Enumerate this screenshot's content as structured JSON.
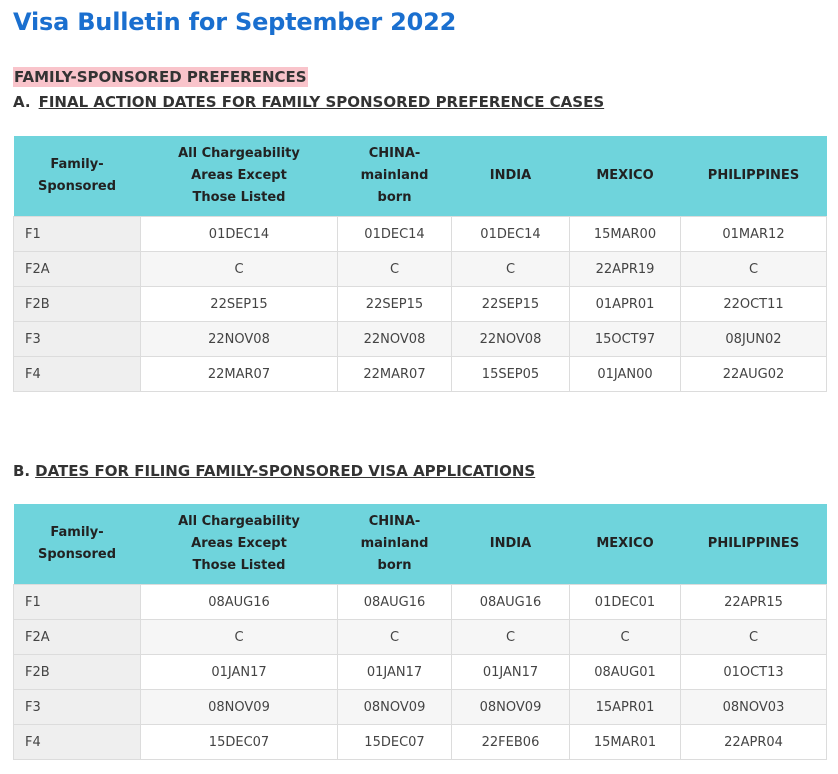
{
  "page": {
    "title": "Visa Bulletin for September 2022",
    "section_label": "FAMILY-SPONSORED PREFERENCES"
  },
  "columns": [
    "Family-\nSponsored",
    "All Chargeability\nAreas Except\nThose Listed",
    "CHINA-\nmainland\nborn",
    "INDIA",
    "MEXICO",
    "PHILIPPINES"
  ],
  "table_a": {
    "letter": "A.",
    "heading": "FINAL ACTION DATES FOR FAMILY SPONSORED PREFERENCE CASES",
    "rows": [
      [
        "F1",
        "01DEC14",
        "01DEC14",
        "01DEC14",
        "15MAR00",
        "01MAR12"
      ],
      [
        "F2A",
        "C",
        "C",
        "C",
        "22APR19",
        "C"
      ],
      [
        "F2B",
        "22SEP15",
        "22SEP15",
        "22SEP15",
        "01APR01",
        "22OCT11"
      ],
      [
        "F3",
        "22NOV08",
        "22NOV08",
        "22NOV08",
        "15OCT97",
        "08JUN02"
      ],
      [
        "F4",
        "22MAR07",
        "22MAR07",
        "15SEP05",
        "01JAN00",
        "22AUG02"
      ]
    ]
  },
  "table_b": {
    "letter": "B.",
    "heading": "DATES FOR FILING FAMILY-SPONSORED VISA APPLICATIONS",
    "rows": [
      [
        "F1",
        "08AUG16",
        "08AUG16",
        "08AUG16",
        "01DEC01",
        "22APR15"
      ],
      [
        "F2A",
        "C",
        "C",
        "C",
        "C",
        "C"
      ],
      [
        "F2B",
        "01JAN17",
        "01JAN17",
        "01JAN17",
        "08AUG01",
        "01OCT13"
      ],
      [
        "F3",
        "08NOV09",
        "08NOV09",
        "08NOV09",
        "15APR01",
        "08NOV03"
      ],
      [
        "F4",
        "15DEC07",
        "15DEC07",
        "22FEB06",
        "15MAR01",
        "22APR04"
      ]
    ]
  },
  "colors": {
    "title": "#1a6fcf",
    "section_highlight": "#f9c4cb",
    "table_header": "#6fd4dc"
  }
}
